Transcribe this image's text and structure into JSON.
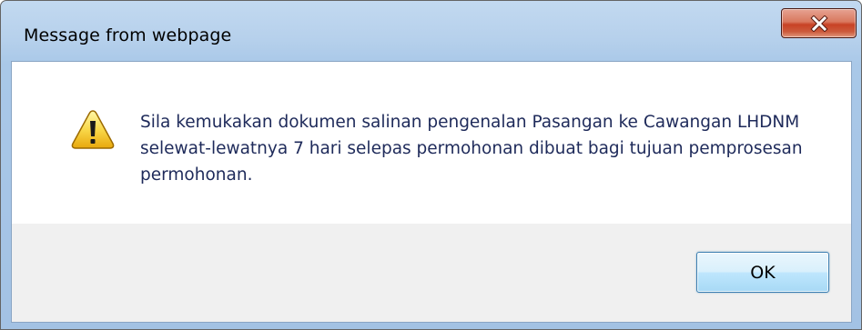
{
  "dialog": {
    "title": "Message from webpage",
    "message": "Sila kemukakan dokumen salinan pengenalan Pasangan ke Cawangan LHDNM selewat-lewatnya 7 hari selepas permohonan dibuat bagi tujuan pemprosesan permohonan.",
    "icon": "warning-icon",
    "ok_label": "OK",
    "close_icon": "close-icon"
  },
  "colors": {
    "titlebar": "#b7d1ec",
    "close_button": "#c84225",
    "ok_button": "#bee6fd",
    "message_text": "#1e2a5a"
  }
}
